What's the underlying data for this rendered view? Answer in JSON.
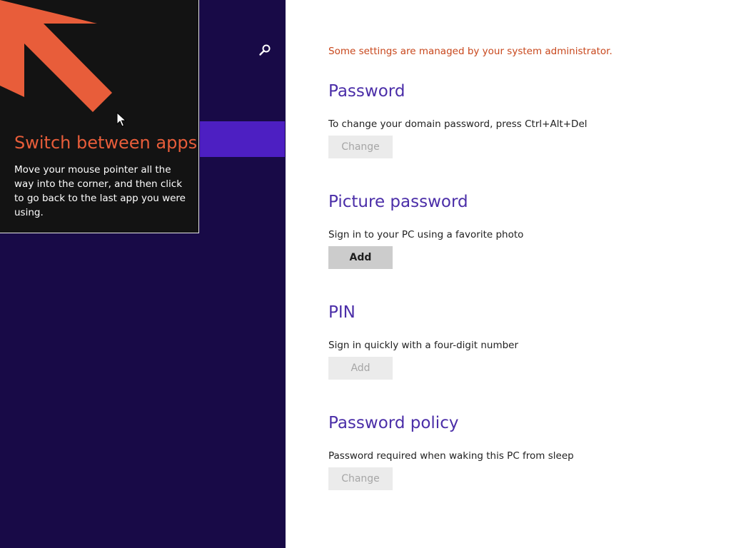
{
  "left_pane": {
    "search_icon": "search-icon",
    "tip": {
      "title": "Switch between apps",
      "body": "Move your mouse pointer all the way into the corner, and then click to go back to the last app you were using.",
      "arrow_icon": "arrow-up-left-icon",
      "accent_color": "#e85d3a"
    }
  },
  "main": {
    "admin_notice": "Some settings are managed by your system administrator.",
    "sections": [
      {
        "title": "Password",
        "description": "To change your domain password, press Ctrl+Alt+Del",
        "button_label": "Change",
        "button_enabled": false
      },
      {
        "title": "Picture password",
        "description": "Sign in to your PC using a favorite photo",
        "button_label": "Add",
        "button_enabled": true
      },
      {
        "title": "PIN",
        "description": "Sign in quickly with a four-digit number",
        "button_label": "Add",
        "button_enabled": false
      },
      {
        "title": "Password policy",
        "description": "Password required when waking this PC from sleep",
        "button_label": "Change",
        "button_enabled": false
      }
    ]
  },
  "colors": {
    "nav_background": "#180a47",
    "nav_selected": "#4d1fc2",
    "heading": "#4b2ea8",
    "notice": "#c8471c"
  }
}
